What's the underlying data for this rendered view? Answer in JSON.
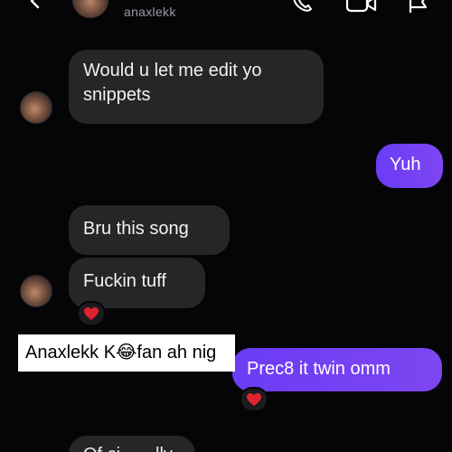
{
  "header": {
    "username": "anaxlekk"
  },
  "messages": [
    {
      "sender": "them",
      "text_line1": "Would u let me edit yo",
      "text_line2": "snippets"
    },
    {
      "sender": "me",
      "text": "Yuh"
    },
    {
      "sender": "them",
      "text": "Bru this song"
    },
    {
      "sender": "them",
      "text": "Fuckin tuff",
      "reaction": "❤️"
    },
    {
      "sender": "me",
      "text": "Prec8 it twin omm",
      "reaction": "❤️"
    },
    {
      "sender": "them",
      "text": "Of ci... ...lly"
    }
  ],
  "overlay": {
    "caption": "Anaxlekk K😂fan ah nig"
  },
  "colors": {
    "background": "#050507",
    "incoming_bubble": "#262629",
    "outgoing_bubble": "#7246f3",
    "heart": "#e0242f"
  },
  "icons": {
    "back": "back-chevron-icon",
    "phone": "phone-icon",
    "video": "video-camera-icon",
    "flag": "flag-icon",
    "heart": "heart-icon"
  }
}
